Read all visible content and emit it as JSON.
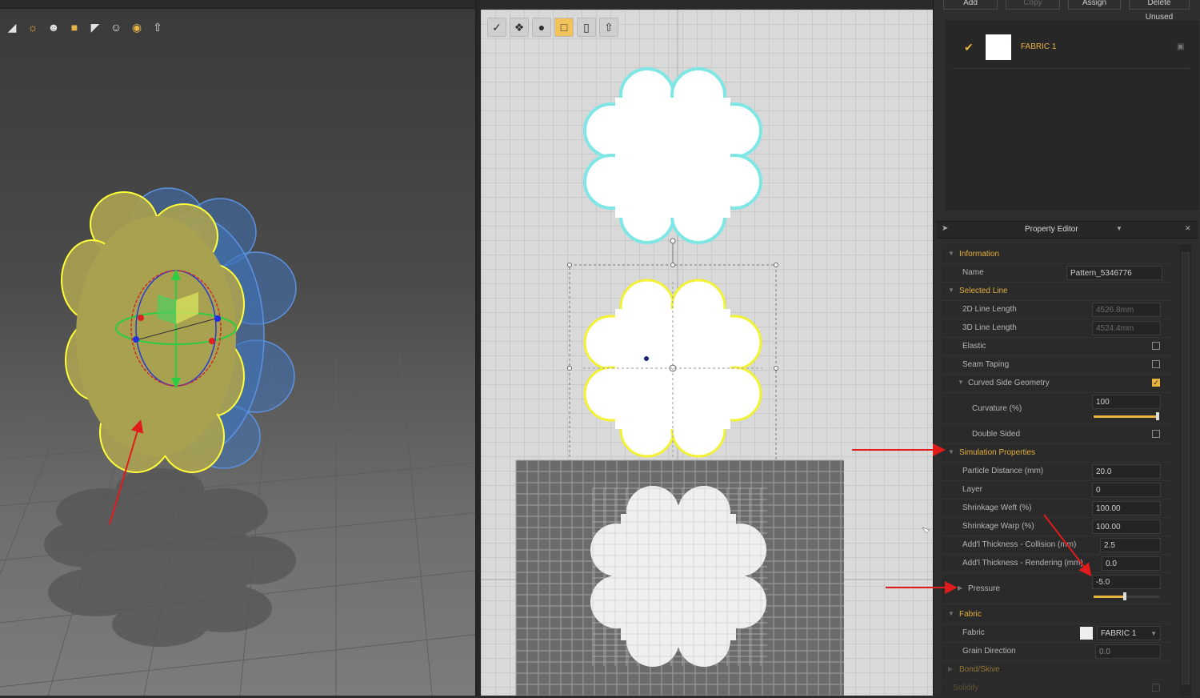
{
  "toolbar3d": {
    "icons": [
      "tshirt-icon",
      "sun-icon",
      "avatar-icon",
      "fabric-icon",
      "shade-icon",
      "avatar-alt-icon",
      "globe-icon",
      "export-icon"
    ]
  },
  "toolbar2d": {
    "icons": [
      "edit-pattern-icon",
      "transform-icon",
      "edit-point-icon",
      "pattern-select-icon",
      "segment-icon",
      "export-icon"
    ]
  },
  "fabric_panel": {
    "buttons": [
      "Add",
      "Copy",
      "Assign",
      "Delete Unused"
    ],
    "items": [
      {
        "name": "FABRIC 1",
        "checked": true,
        "swatch_color": "#ffffff"
      }
    ]
  },
  "property_editor": {
    "title": "Property Editor",
    "information": {
      "label": "Information",
      "name_label": "Name",
      "name_value": "Pattern_5346776"
    },
    "selected_line": {
      "label": "Selected Line",
      "line2d_label": "2D Line Length",
      "line2d_value": "4526.8mm",
      "line3d_label": "3D Line Length",
      "line3d_value": "4524.4mm",
      "elastic_label": "Elastic",
      "seam_label": "Seam Taping",
      "curved_label": "Curved Side Geometry",
      "curvature_label": "Curvature (%)",
      "curvature_value": "100",
      "curvature_fraction": 1.0,
      "double_label": "Double Sided"
    },
    "simulation": {
      "label": "Simulation Properties",
      "particle_label": "Particle Distance (mm)",
      "particle_value": "20.0",
      "layer_label": "Layer",
      "layer_value": "0",
      "weft_label": "Shrinkage Weft (%)",
      "weft_value": "100.00",
      "warp_label": "Shrinkage Warp (%)",
      "warp_value": "100.00",
      "collision_label": "Add'l Thickness - Collision (mm)",
      "collision_value": "2.5",
      "rendering_label": "Add'l Thickness - Rendering (mm)",
      "rendering_value": "0.0",
      "pressure_label": "Pressure",
      "pressure_value": "-5.0",
      "pressure_fraction": 0.5
    },
    "fabric": {
      "label": "Fabric",
      "fabric_label": "Fabric",
      "fabric_value": "FABRIC 1",
      "grain_label": "Grain Direction",
      "grain_value": "0.0"
    },
    "bond_label": "Bond/Skive",
    "solidify_label": "Solidify"
  },
  "colors": {
    "accent": "#e7b43e",
    "annotation_arrow": "#e01b1b",
    "selection_outline": "#f2f235",
    "pattern_glow": "#7fe6e6"
  }
}
